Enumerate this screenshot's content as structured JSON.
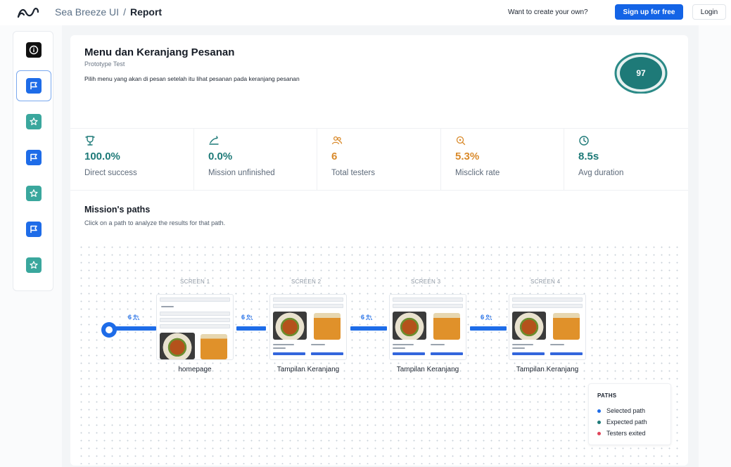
{
  "header": {
    "app_name": "Sea Breeze UI",
    "separator": "/",
    "page": "Report",
    "cta_text": "Want to create your own?",
    "signup_label": "Sign up for free",
    "login_label": "Login"
  },
  "sidebar": {
    "items": [
      {
        "icon": "info-icon",
        "color": "#111111"
      },
      {
        "icon": "flag-icon",
        "color": "#1e6ce8",
        "active": true
      },
      {
        "icon": "star-icon",
        "color": "#3aa79d"
      },
      {
        "icon": "flag-icon",
        "color": "#1e6ce8"
      },
      {
        "icon": "star-icon",
        "color": "#3aa79d"
      },
      {
        "icon": "flag-icon",
        "color": "#1e6ce8"
      },
      {
        "icon": "star-icon",
        "color": "#3aa79d"
      }
    ]
  },
  "mission": {
    "title": "Menu dan Keranjang Pesanan",
    "subtitle": "Prototype Test",
    "description": "Pilih menu yang akan di pesan setelah itu lihat pesanan pada keranjang pesanan",
    "score": "97",
    "score_color": "#1e7a78"
  },
  "metrics": [
    {
      "icon": "trophy-icon",
      "value": "100.0%",
      "label": "Direct success",
      "color": "#1e7a78"
    },
    {
      "icon": "unfinished-icon",
      "value": "0.0%",
      "label": "Mission unfinished",
      "color": "#1e7a78"
    },
    {
      "icon": "testers-icon",
      "value": "6",
      "label": "Total testers",
      "color": "#d98a2b"
    },
    {
      "icon": "misclick-icon",
      "value": "5.3%",
      "label": "Misclick rate",
      "color": "#d98a2b"
    },
    {
      "icon": "clock-icon",
      "value": "8.5s",
      "label": "Avg duration",
      "color": "#1e7a78"
    }
  ],
  "paths": {
    "title": "Mission's paths",
    "subtitle": "Click on a path to analyze the results for that path.",
    "screens": [
      {
        "label": "SCREEN 1",
        "name": "homepage",
        "count": "6"
      },
      {
        "label": "SCREEN 2",
        "name": "Tampilan Keranjang",
        "count": "6"
      },
      {
        "label": "SCREEN 3",
        "name": "Tampilan Keranjang",
        "count": "6"
      },
      {
        "label": "SCREEN 4",
        "name": "Tampilan Keranjang",
        "count": "6"
      }
    ],
    "flow_color": "#1e6ce8"
  },
  "legend": {
    "title": "PATHS",
    "items": [
      {
        "label": "Selected path",
        "color": "#1e6ce8"
      },
      {
        "label": "Expected path",
        "color": "#1e7a78"
      },
      {
        "label": "Testers exited",
        "color": "#e0455a"
      }
    ]
  }
}
